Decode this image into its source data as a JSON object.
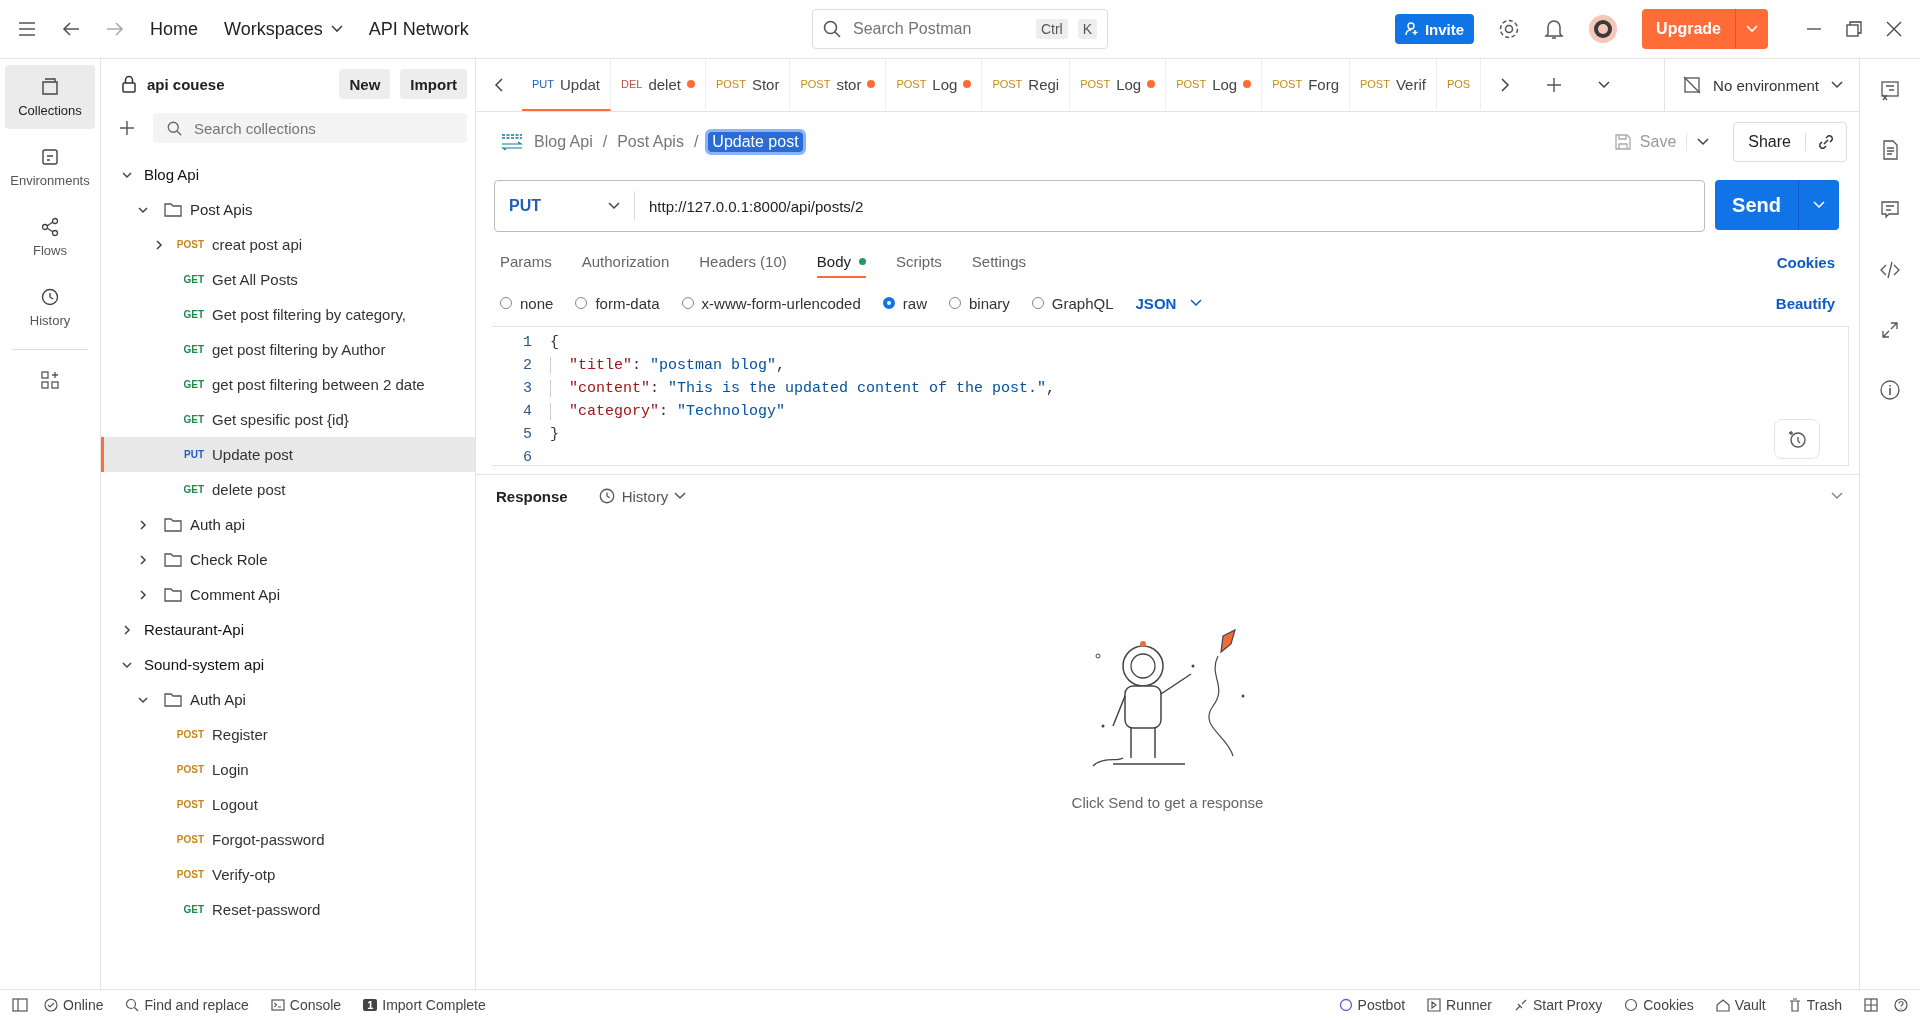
{
  "topbar": {
    "nav": [
      {
        "label": "Home",
        "dropdown": false
      },
      {
        "label": "Workspaces",
        "dropdown": true
      },
      {
        "label": "API Network",
        "dropdown": false
      }
    ],
    "search": {
      "placeholder": "Search Postman",
      "keys": [
        "Ctrl",
        "K"
      ]
    },
    "invite": "Invite",
    "upgrade": "Upgrade"
  },
  "leftnav": [
    {
      "label": "Collections",
      "selected": true
    },
    {
      "label": "Environments",
      "selected": false
    },
    {
      "label": "Flows",
      "selected": false
    },
    {
      "label": "History",
      "selected": false
    }
  ],
  "sidebar": {
    "workspace": "api couese",
    "new_button": "New",
    "import_button": "Import",
    "search_placeholder": "Search collections",
    "tree": [
      {
        "label": "Blog Api",
        "kind": "collection",
        "expanded": true,
        "selected": false,
        "children": [
          {
            "label": "Post Apis",
            "kind": "folder",
            "expanded": true,
            "selected": false,
            "children": [
              {
                "label": "creat post api",
                "kind": "request",
                "method": "POST",
                "color": "#c7881b",
                "expanded": false,
                "selected": false
              },
              {
                "label": "Get All Posts",
                "kind": "request",
                "method": "GET",
                "color": "#1f8a4c",
                "selected": false
              },
              {
                "label": "Get post filtering by category,",
                "kind": "request",
                "method": "GET",
                "color": "#1f8a4c",
                "selected": false
              },
              {
                "label": "get post filtering by Author",
                "kind": "request",
                "method": "GET",
                "color": "#1f8a4c",
                "selected": false
              },
              {
                "label": "get post filtering between 2 date",
                "kind": "request",
                "method": "GET",
                "color": "#1f8a4c",
                "selected": false
              },
              {
                "label": "Get spesific post {id}",
                "kind": "request",
                "method": "GET",
                "color": "#1f8a4c",
                "selected": false
              },
              {
                "label": "Update post",
                "kind": "request",
                "method": "PUT",
                "color": "#1f5fb5",
                "selected": true
              },
              {
                "label": "delete post",
                "kind": "request",
                "method": "GET",
                "color": "#1f8a4c",
                "selected": false
              }
            ]
          },
          {
            "label": "Auth api",
            "kind": "folder",
            "expanded": false,
            "selected": false
          },
          {
            "label": "Check Role",
            "kind": "folder",
            "expanded": false,
            "selected": false
          },
          {
            "label": "Comment Api",
            "kind": "folder",
            "expanded": false,
            "selected": false
          }
        ]
      },
      {
        "label": "Restaurant-Api",
        "kind": "collection",
        "expanded": false,
        "selected": false
      },
      {
        "label": "Sound-system api",
        "kind": "collection",
        "expanded": true,
        "selected": false,
        "children": [
          {
            "label": "Auth Api",
            "kind": "folder",
            "expanded": true,
            "selected": false,
            "children": [
              {
                "label": "Register",
                "kind": "request",
                "method": "POST",
                "color": "#c7881b",
                "selected": false
              },
              {
                "label": "Login",
                "kind": "request",
                "method": "POST",
                "color": "#c7881b",
                "selected": false
              },
              {
                "label": "Logout",
                "kind": "request",
                "method": "POST",
                "color": "#c7881b",
                "selected": false
              },
              {
                "label": "Forgot-password",
                "kind": "request",
                "method": "POST",
                "color": "#c7881b",
                "selected": false
              },
              {
                "label": "Verify-otp",
                "kind": "request",
                "method": "POST",
                "color": "#c7881b",
                "selected": false
              },
              {
                "label": "Reset-password",
                "kind": "request",
                "method": "GET",
                "color": "#1f8a4c",
                "selected": false
              }
            ]
          }
        ]
      }
    ]
  },
  "tabs": [
    {
      "method": "PUT",
      "color": "#1f5fb5",
      "label": "Updat",
      "unsaved": false,
      "selected": true
    },
    {
      "method": "DEL",
      "color": "#b5524a",
      "label": "delet",
      "unsaved": true,
      "selected": false
    },
    {
      "method": "POST",
      "color": "#c7881b",
      "label": "Stor",
      "unsaved": false,
      "selected": false
    },
    {
      "method": "POST",
      "color": "#c7881b",
      "label": "stor",
      "unsaved": true,
      "selected": false
    },
    {
      "method": "POST",
      "color": "#c7881b",
      "label": "Log",
      "unsaved": true,
      "selected": false
    },
    {
      "method": "POST",
      "color": "#c7881b",
      "label": "Regi",
      "unsaved": false,
      "selected": false
    },
    {
      "method": "POST",
      "color": "#c7881b",
      "label": "Log",
      "unsaved": true,
      "selected": false
    },
    {
      "method": "POST",
      "color": "#c7881b",
      "label": "Log",
      "unsaved": true,
      "selected": false
    },
    {
      "method": "POST",
      "color": "#c7881b",
      "label": "Forg",
      "unsaved": false,
      "selected": false
    },
    {
      "method": "POST",
      "color": "#c7881b",
      "label": "Verif",
      "unsaved": false,
      "selected": false
    },
    {
      "method": "POS",
      "color": "#c7881b",
      "unsaved": false,
      "selected": false
    }
  ],
  "environment": "No environment",
  "breadcrumb": [
    {
      "label": "Blog Api",
      "separator": "/"
    },
    {
      "label": "Post Apis",
      "separator": "/"
    }
  ],
  "request_name": "Update post",
  "save": "Save",
  "share": "Share",
  "request": {
    "method": "PUT",
    "url": "http://127.0.0.1:8000/api/posts/2",
    "send": "Send"
  },
  "request_tabs": [
    {
      "label": "Params",
      "indicator": false,
      "selected": false
    },
    {
      "label": "Authorization",
      "indicator": false,
      "selected": false
    },
    {
      "label": "Headers (10)",
      "indicator": false,
      "selected": false
    },
    {
      "label": "Body",
      "indicator": true,
      "selected": true
    },
    {
      "label": "Scripts",
      "indicator": false,
      "selected": false
    },
    {
      "label": "Settings",
      "indicator": false,
      "selected": false
    }
  ],
  "cookies_link": "Cookies",
  "body_types": [
    {
      "label": "none",
      "selected": false
    },
    {
      "label": "form-data",
      "selected": false
    },
    {
      "label": "x-www-form-urlencoded",
      "selected": false
    },
    {
      "label": "raw",
      "selected": true
    },
    {
      "label": "binary",
      "selected": false
    },
    {
      "label": "GraphQL",
      "selected": false
    }
  ],
  "format": "JSON",
  "beautify": "Beautify",
  "code": [
    {
      "number": "1",
      "tokens": [
        {
          "text": "{",
          "kind": "punct"
        }
      ]
    },
    {
      "number": "2",
      "tokens": [
        {
          "text": "\"title\"",
          "kind": "key"
        },
        {
          "text": ": ",
          "kind": "punct"
        },
        {
          "text": "\"postman blog\"",
          "kind": "string"
        },
        {
          "text": ",",
          "kind": "punct"
        }
      ]
    },
    {
      "number": "3",
      "tokens": [
        {
          "text": "\"content\"",
          "kind": "key"
        },
        {
          "text": ": ",
          "kind": "punct"
        },
        {
          "text": "\"This is the updated content of the post.\"",
          "kind": "string"
        },
        {
          "text": ",",
          "kind": "punct"
        }
      ]
    },
    {
      "number": "4",
      "tokens": [
        {
          "text": "\"category\"",
          "kind": "key"
        },
        {
          "text": ": ",
          "kind": "punct"
        },
        {
          "text": "\"Technology\"",
          "kind": "string"
        }
      ]
    },
    {
      "number": "5",
      "tokens": [
        {
          "text": "}",
          "kind": "punct"
        }
      ]
    },
    {
      "number": "6"
    }
  ],
  "response": {
    "title": "Response",
    "history": "History",
    "empty_message": "Click Send to get a response"
  },
  "status_left": [
    {
      "label": "Online"
    },
    {
      "label": "Find and replace"
    },
    {
      "label": "Console"
    },
    {
      "label": "Import Complete",
      "badge": "1"
    }
  ],
  "status_right": [
    {
      "label": "Postbot"
    },
    {
      "label": "Runner"
    },
    {
      "label": "Start Proxy"
    },
    {
      "label": "Cookies"
    },
    {
      "label": "Vault"
    },
    {
      "label": "Trash"
    }
  ]
}
